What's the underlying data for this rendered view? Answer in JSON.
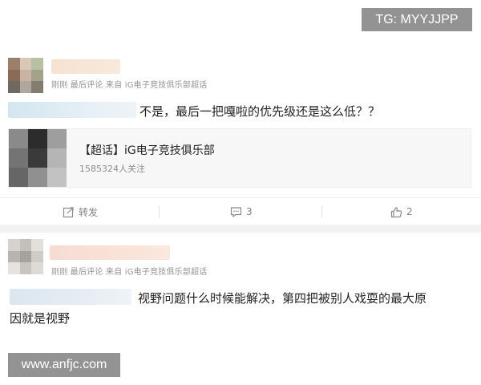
{
  "watermark_top": "TG: MYYJJPP",
  "watermark_bottom": "www.anfjc.com",
  "posts": [
    {
      "meta": "刚刚 最后评论 来自 iG电子竞技俱乐部超话",
      "content": "不是，最后一把嘎啦的优先级还是这么低？？",
      "card": {
        "title": "【超话】iG电子竞技俱乐部",
        "followers": "1585324人关注"
      },
      "actions": {
        "repost_label": "转发",
        "comment_count": "3",
        "like_count": "2"
      }
    },
    {
      "meta": "刚刚 最后评论 来自 iG电子竞技俱乐部超话",
      "content_line1": "视野问题什么时候能解决，第四把被别人戏耍的最大原",
      "content_line2": "因就是视野"
    }
  ],
  "icons": {
    "repost": "repost-icon",
    "comment": "comment-icon",
    "like": "thumbs-up-icon"
  },
  "colors": {
    "meta_text": "#939393",
    "action_text": "#828282",
    "body_text": "#222222",
    "card_bg": "#f7f7f7",
    "divider_bg": "#f2f2f2"
  }
}
